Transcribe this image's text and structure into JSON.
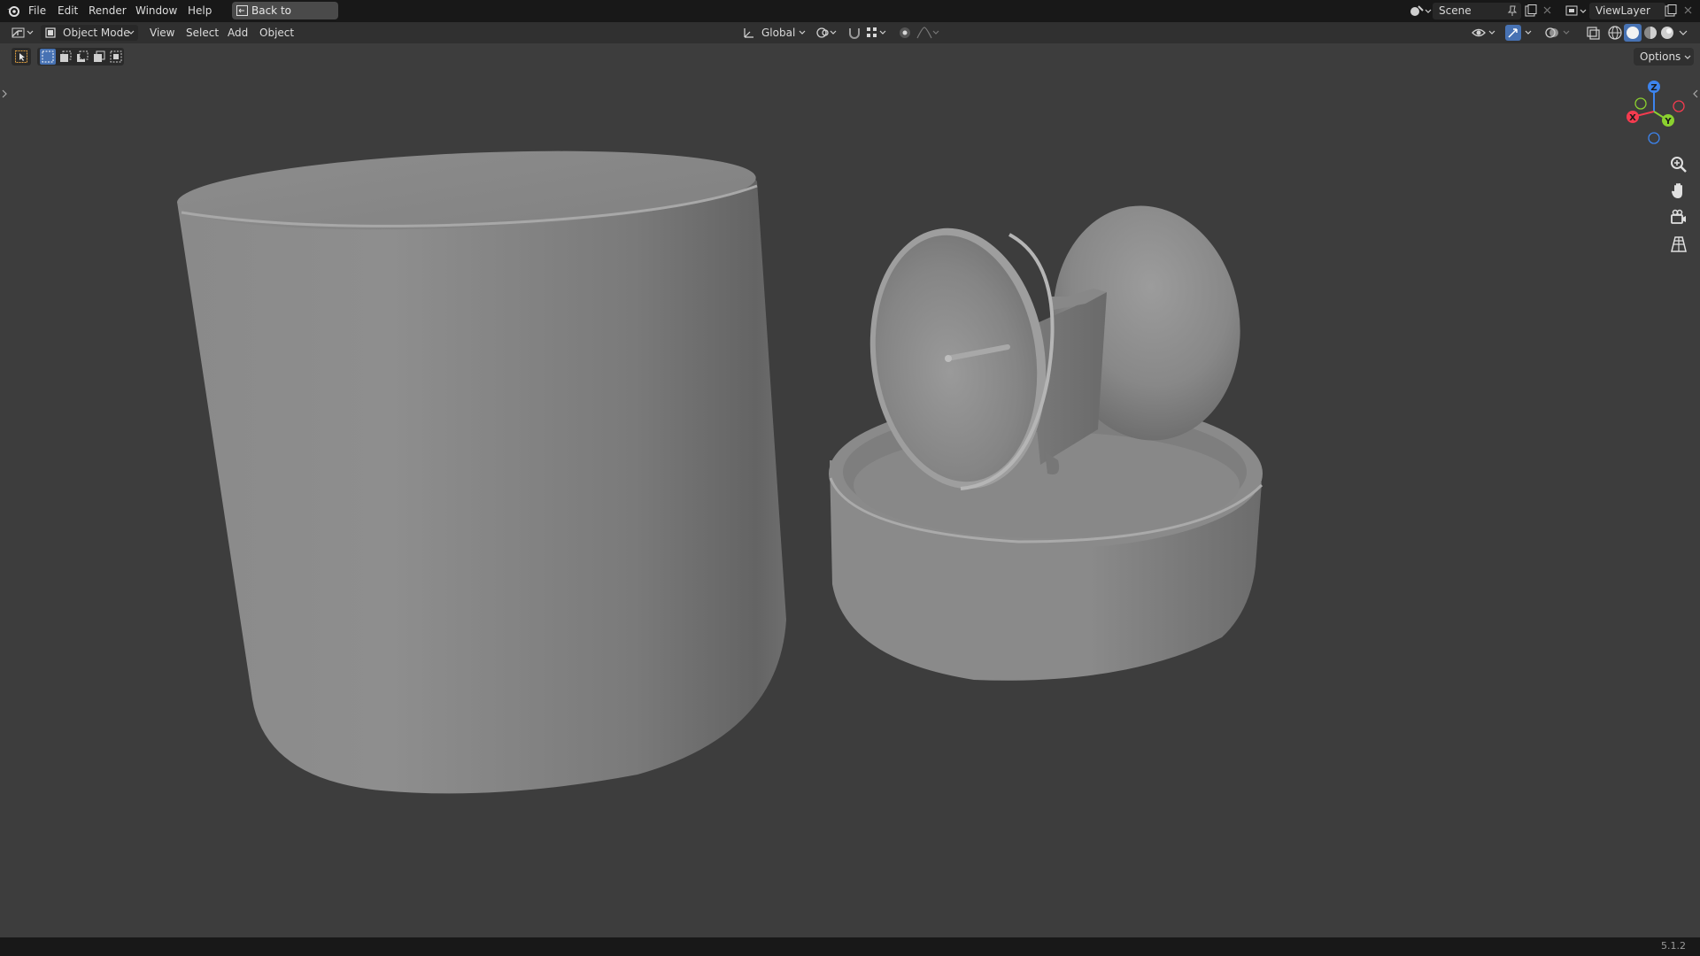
{
  "topbar": {
    "menus": [
      "File",
      "Edit",
      "Render",
      "Window",
      "Help"
    ],
    "back_button": "Back to Previous",
    "scene": "Scene",
    "view_layer": "ViewLayer"
  },
  "header": {
    "mode": "Object Mode",
    "menus": [
      "View",
      "Select",
      "Add",
      "Object"
    ],
    "transform_orientation": "Global",
    "options": "Options"
  },
  "gizmo": {
    "x": "X",
    "y": "Y",
    "z": "Z"
  },
  "status": {
    "version": "5.1.2"
  },
  "colors": {
    "accent": "#4772b3",
    "x_axis": "#f53b4f",
    "y_axis": "#8bd12f",
    "z_axis": "#3d84ee",
    "viewport_bg": "#3d3d3d"
  }
}
